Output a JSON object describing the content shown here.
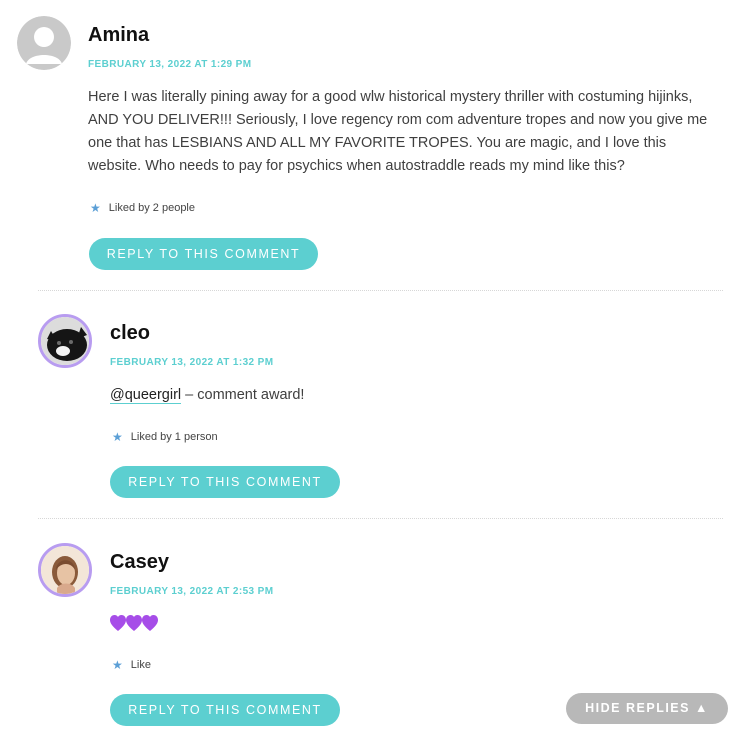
{
  "comments": [
    {
      "author": "Amina",
      "date": "FEBRUARY 13, 2022 AT 1:29 PM",
      "text": "Here I was literally pining away for a good wlw historical mystery thriller with costuming hijinks, AND YOU DELIVER!!! Seriously, I love regency rom com adventure tropes and now you give me one that has LESBIANS AND ALL MY FAVORITE TROPES. You are magic, and I love this website. Who needs to pay for psychics when autostraddle reads my mind like this?",
      "likes": "Liked by 2 people",
      "reply": "REPLY TO THIS COMMENT"
    },
    {
      "author": "cleo",
      "date": "FEBRUARY 13, 2022 AT 1:32 PM",
      "mention": "@queergirl",
      "text": " – comment award!",
      "likes": "Liked by 1 person",
      "reply": "REPLY TO THIS COMMENT"
    },
    {
      "author": "Casey",
      "date": "FEBRUARY 13, 2022 AT 2:53 PM",
      "emoji": "💜💜💜",
      "likes": "Like",
      "reply": "REPLY TO THIS COMMENT"
    }
  ],
  "hide_replies": "HIDE REPLIES ▲",
  "colors": {
    "accent": "#5ccfd0",
    "avatar_ring": "#b89cf0",
    "star": "#5b9fd6",
    "hide_button": "#b8b8b8"
  }
}
